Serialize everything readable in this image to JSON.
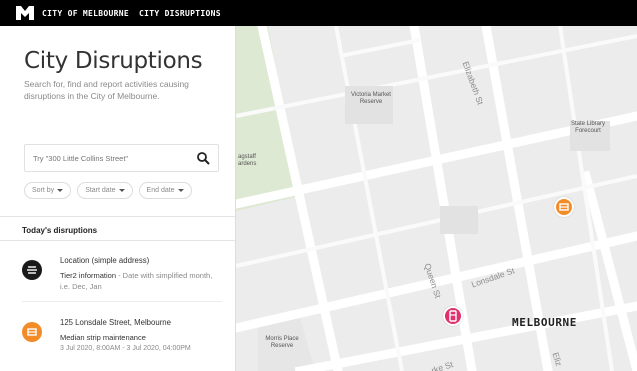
{
  "header": {
    "brand": "CITY OF MELBOURNE",
    "section": "CITY DISRUPTIONS"
  },
  "panel": {
    "title": "City Disruptions",
    "intro": "Search for, find and report activities causing disruptions in the City of Melbourne.",
    "search": {
      "placeholder": "Try \"300 Little Collins Street\""
    },
    "filters": {
      "sort": "Sort by",
      "start": "Start date",
      "end": "End date"
    },
    "section_title": "Today's disruptions",
    "items": [
      {
        "title": "Location (simple address)",
        "line2_bold": "Tier2 information",
        "line2_rest": " - Date with simplified month, i.e. Dec, Jan",
        "line3": ""
      },
      {
        "title": "125 Lonsdale Street, Melbourne",
        "line2_bold": "Median strip maintenance",
        "line2_rest": "",
        "line3": "3 Jul 2020, 8:00AM - 3 Jul 2020, 04:00PM"
      }
    ]
  },
  "map": {
    "labels": {
      "victoria_market": "Victoria Market Reserve",
      "state_library": "State Library Forecourt",
      "flagstaff": "agstaff ardens",
      "morris_place": "Morris Place Reserve",
      "melbourne": "MELBOURNE"
    },
    "streets": {
      "elizabeth_top": "Elizabeth St",
      "lonsdale": "Lonsdale St",
      "queen": "Queen St",
      "bourke": "rke St",
      "elizabeth_bottom": "Eliz"
    }
  },
  "colors": {
    "accent_orange": "#f28c28",
    "pin_magenta": "#e0306e",
    "park_green": "#dde9d3"
  }
}
